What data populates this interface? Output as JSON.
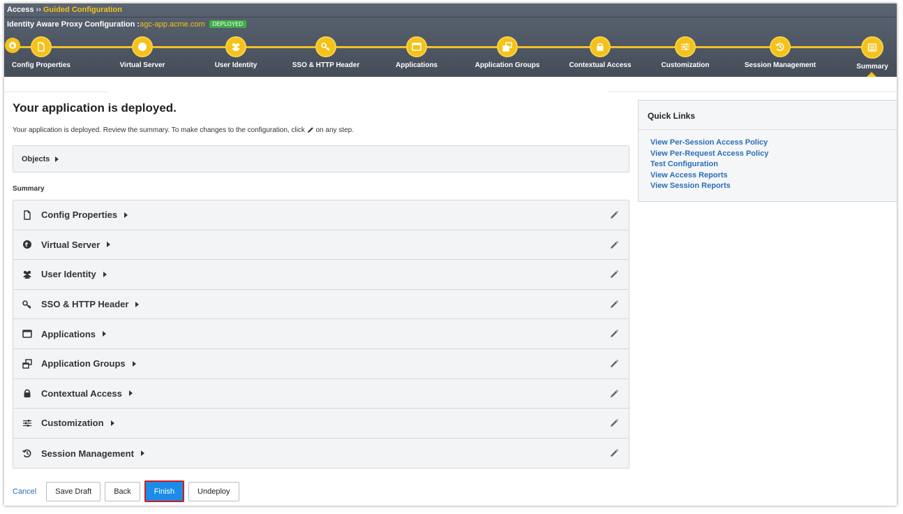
{
  "breadcrumb": {
    "root": "Access",
    "separator": "››",
    "current": "Guided Configuration"
  },
  "header": {
    "title": "Identity Aware Proxy Configuration :",
    "host": "agc-app.acme.com",
    "status_badge": "DEPLOYED"
  },
  "steps": [
    {
      "label": "Config Properties",
      "icon": "document-icon"
    },
    {
      "label": "Virtual Server",
      "icon": "globe-icon"
    },
    {
      "label": "User Identity",
      "icon": "users-icon"
    },
    {
      "label": "SSO & HTTP Header",
      "icon": "key-icon"
    },
    {
      "label": "Applications",
      "icon": "window-icon"
    },
    {
      "label": "Application Groups",
      "icon": "windows-group-icon"
    },
    {
      "label": "Contextual Access",
      "icon": "lock-icon"
    },
    {
      "label": "Customization",
      "icon": "sliders-icon"
    },
    {
      "label": "Session Management",
      "icon": "history-icon"
    },
    {
      "label": "Summary",
      "icon": "summary-icon",
      "active": true
    }
  ],
  "main": {
    "title": "Your application is deployed.",
    "description_prefix": "Your application is deployed. Review the summary. To make changes to the configuration, click",
    "description_suffix": "on any step.",
    "objects_label": "Objects",
    "summary_heading": "Summary",
    "summary_items": [
      {
        "label": "Config Properties",
        "icon": "document-icon"
      },
      {
        "label": "Virtual Server",
        "icon": "globe-icon"
      },
      {
        "label": "User Identity",
        "icon": "users-icon"
      },
      {
        "label": "SSO & HTTP Header",
        "icon": "key-icon"
      },
      {
        "label": "Applications",
        "icon": "window-icon"
      },
      {
        "label": "Application Groups",
        "icon": "windows-group-icon"
      },
      {
        "label": "Contextual Access",
        "icon": "lock-icon"
      },
      {
        "label": "Customization",
        "icon": "sliders-icon"
      },
      {
        "label": "Session Management",
        "icon": "history-icon"
      }
    ]
  },
  "actions": {
    "cancel": "Cancel",
    "save_draft": "Save Draft",
    "back": "Back",
    "finish": "Finish",
    "undeploy": "Undeploy"
  },
  "quick_links": {
    "title": "Quick Links",
    "links": [
      "View Per-Session Access Policy",
      "View Per-Request Access Policy",
      "Test Configuration",
      "View Access Reports",
      "View Session Reports"
    ]
  },
  "colors": {
    "accent_yellow": "#f4c21a",
    "link_blue": "#2a6ebb",
    "primary_button": "#1c8ce8",
    "badge_green": "#3fae49",
    "highlight_red": "#d21a1a"
  }
}
